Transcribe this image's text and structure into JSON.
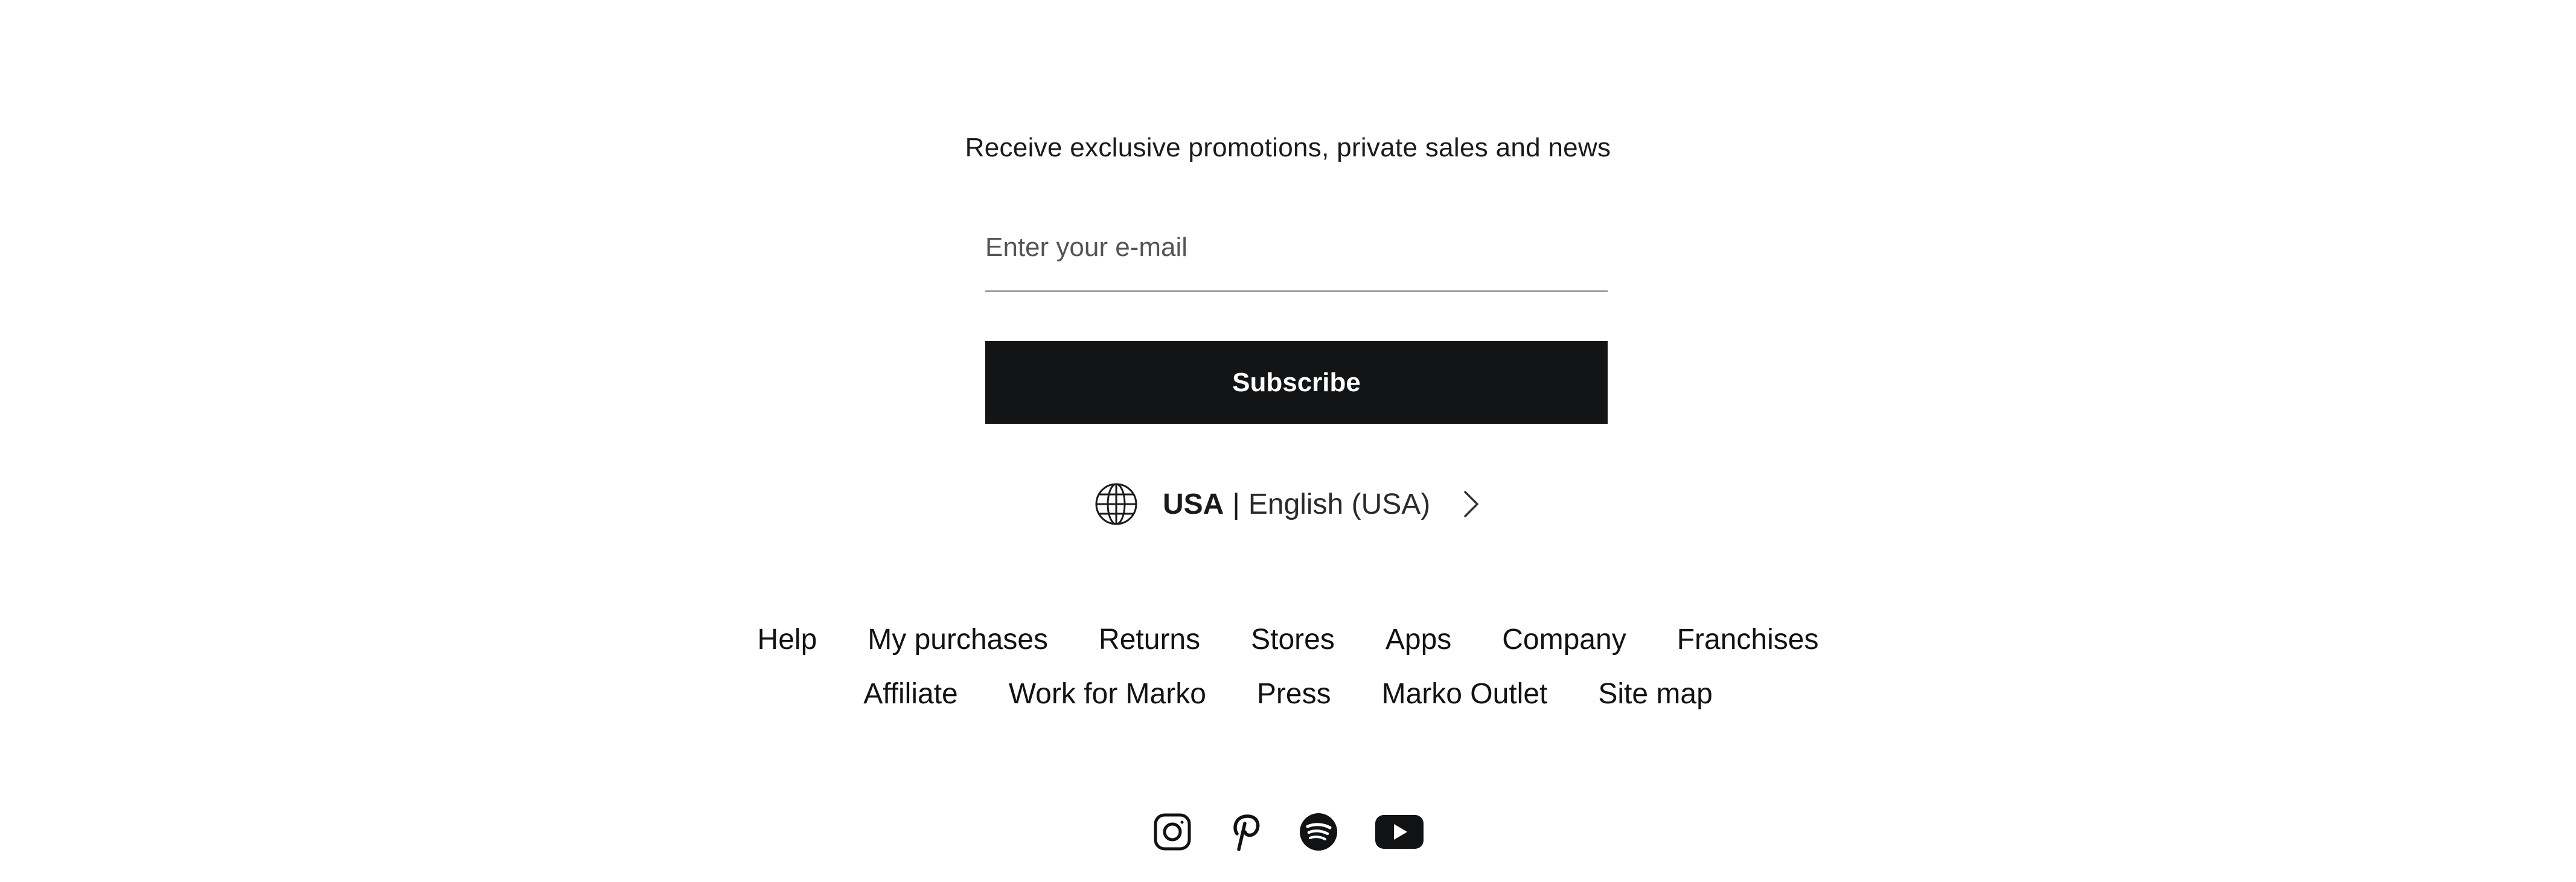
{
  "newsletter": {
    "heading": "Receive exclusive promotions, private sales and news",
    "email_placeholder": "Enter your e-mail",
    "email_value": "",
    "subscribe_label": "Subscribe"
  },
  "locale": {
    "icon": "globe-icon",
    "country": "USA",
    "separator": "|",
    "language": "English (USA)",
    "chevron_icon": "chevron-right-icon"
  },
  "footer_links": {
    "row1": [
      "Help",
      "My purchases",
      "Returns",
      "Stores",
      "Apps",
      "Company",
      "Franchises"
    ],
    "row2": [
      "Affiliate",
      "Work for Marko",
      "Press",
      "Marko Outlet",
      "Site map"
    ]
  },
  "social": [
    {
      "icon": "instagram-icon"
    },
    {
      "icon": "pinterest-icon"
    },
    {
      "icon": "spotify-icon"
    },
    {
      "icon": "youtube-icon"
    }
  ],
  "colors": {
    "button_bg": "#131416",
    "button_text": "#ffffff",
    "text": "#111214",
    "input_underline": "#9a9a9a"
  }
}
